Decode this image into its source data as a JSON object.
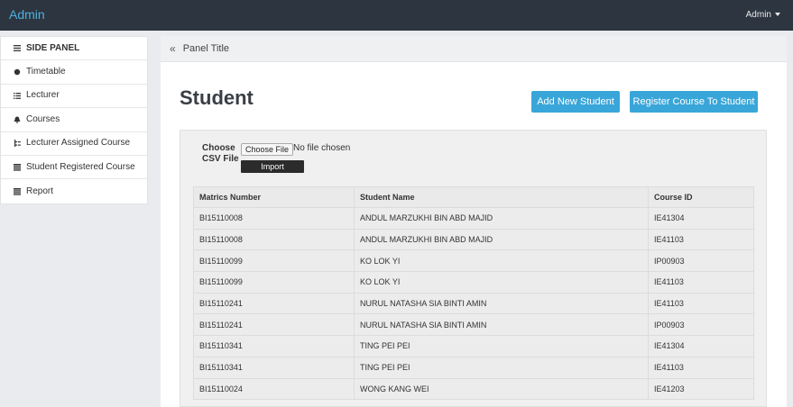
{
  "app": {
    "brand": "Admin",
    "user_menu": "Admin"
  },
  "sidebar": {
    "items": [
      {
        "label": "SIDE PANEL",
        "icon": "list-icon"
      },
      {
        "label": "Timetable",
        "icon": "circle-icon"
      },
      {
        "label": "Lecturer",
        "icon": "list-icon"
      },
      {
        "label": "Courses",
        "icon": "bell-icon"
      },
      {
        "label": "Lecturer Assigned Course",
        "icon": "tree-icon"
      },
      {
        "label": "Student Registered Course",
        "icon": "table-icon"
      },
      {
        "label": "Report",
        "icon": "table-icon"
      }
    ]
  },
  "panel": {
    "title": "Panel Title",
    "back_icon": "double-chevron-left-icon"
  },
  "page": {
    "title": "Student",
    "add_button": "Add New Student",
    "register_button": "Register Course To Student"
  },
  "import": {
    "label_line1": "Choose",
    "label_line2": "CSV File",
    "file_button": "Choose File",
    "file_status": "No file chosen",
    "import_button": "Import"
  },
  "table": {
    "headers": [
      "Matrics Number",
      "Student Name",
      "Course ID"
    ],
    "rows": [
      [
        "BI15110008",
        "ANDUL MARZUKHI BIN ABD MAJID",
        "IE41304"
      ],
      [
        "BI15110008",
        "ANDUL MARZUKHI BIN ABD MAJID",
        "IE41103"
      ],
      [
        "BI15110099",
        "KO LOK YI",
        "IP00903"
      ],
      [
        "BI15110099",
        "KO LOK YI",
        "IE41103"
      ],
      [
        "BI15110241",
        "NURUL NATASHA SIA BINTI AMIN",
        "IE41103"
      ],
      [
        "BI15110241",
        "NURUL NATASHA SIA BINTI AMIN",
        "IP00903"
      ],
      [
        "BI15110341",
        "TING PEI PEI",
        "IE41304"
      ],
      [
        "BI15110341",
        "TING PEI PEI",
        "IE41103"
      ],
      [
        "BI15110024",
        "WONG KANG WEI",
        "IE41203"
      ]
    ]
  },
  "colors": {
    "topbar": "#2d3540",
    "brand": "#4fb0e0",
    "button": "#39a6d9"
  }
}
